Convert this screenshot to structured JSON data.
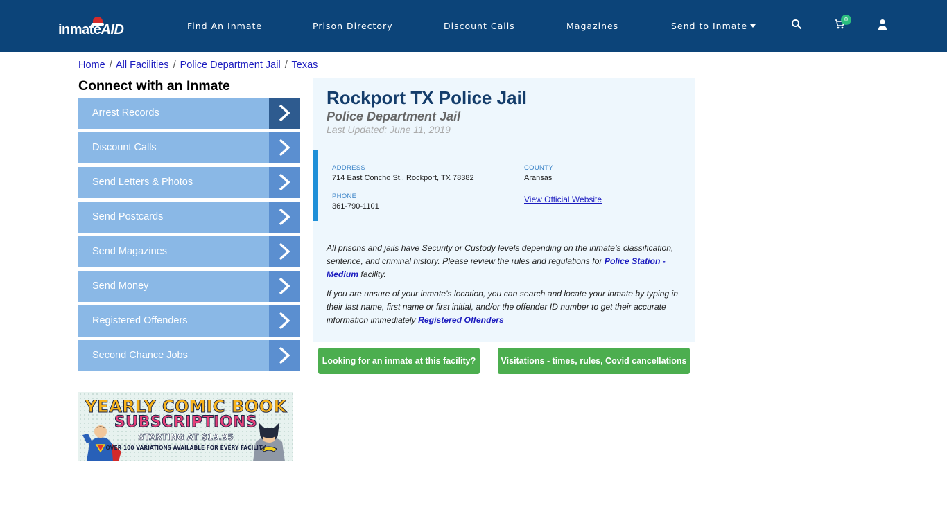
{
  "header": {
    "logo": {
      "text_main": "inmate",
      "text_accent": "AID"
    },
    "nav": [
      {
        "label": "Find An Inmate"
      },
      {
        "label": "Prison Directory"
      },
      {
        "label": "Discount Calls"
      },
      {
        "label": "Magazines"
      },
      {
        "label": "Send to Inmate"
      }
    ],
    "icons": {
      "search": "search-icon",
      "cart": "cart-icon",
      "user": "user-icon"
    },
    "cart_count": "0"
  },
  "breadcrumb": {
    "items": [
      "Home",
      "All Facilities",
      "Police Department Jail",
      "Texas"
    ],
    "separator": "/"
  },
  "sidebar": {
    "title": "Connect with an Inmate",
    "items": [
      {
        "label": "Arrest Records"
      },
      {
        "label": "Discount Calls"
      },
      {
        "label": "Send Letters & Photos"
      },
      {
        "label": "Send Postcards"
      },
      {
        "label": "Send Magazines"
      },
      {
        "label": "Send Money"
      },
      {
        "label": "Registered Offenders"
      },
      {
        "label": "Second Chance Jobs"
      }
    ]
  },
  "banner": {
    "line1": "YEARLY COMIC BOOK",
    "line2": "SUBSCRIPTIONS",
    "line3": "STARTING AT $19.95",
    "line4": "OVER 100 VARIATIONS AVAILABLE FOR EVERY FACILITY"
  },
  "facility": {
    "title": "Rockport TX Police Jail",
    "subtitle": "Police Department Jail",
    "updated": "Last Updated: June 11, 2019",
    "address_label": "ADDRESS",
    "address": "714 East Concho St., Rockport, TX 78382",
    "county_label": "COUNTY",
    "county": "Aransas",
    "phone_label": "PHONE",
    "phone": "361-790-1101",
    "website_link": "View Official Website",
    "para1_a": "All prisons and jails have Security or Custody levels depending on the inmate’s classification, sentence, and criminal history. Please review the rules and regulations for ",
    "para1_link": "Police Station - Medium",
    "para1_b": " facility.",
    "para2_a": "If you are unsure of your inmate's location, you can search and locate your inmate by typing in their last name, first name or first initial, and/or the offender ID number to get their accurate information immediately ",
    "para2_link": "Registered Offenders"
  },
  "buttons": {
    "looking": "Looking for an inmate at this facility?",
    "visitations": "Visitations - times, rules, Covid cancellations"
  },
  "colors": {
    "header_bg": "#0c4479",
    "sidebar_item": "#8ab8e6",
    "sidebar_arrow": "#5b8fd0",
    "card_bg": "#eef7fd",
    "button_green": "#4cae4f",
    "accent_blue": "#1e8fd8"
  }
}
